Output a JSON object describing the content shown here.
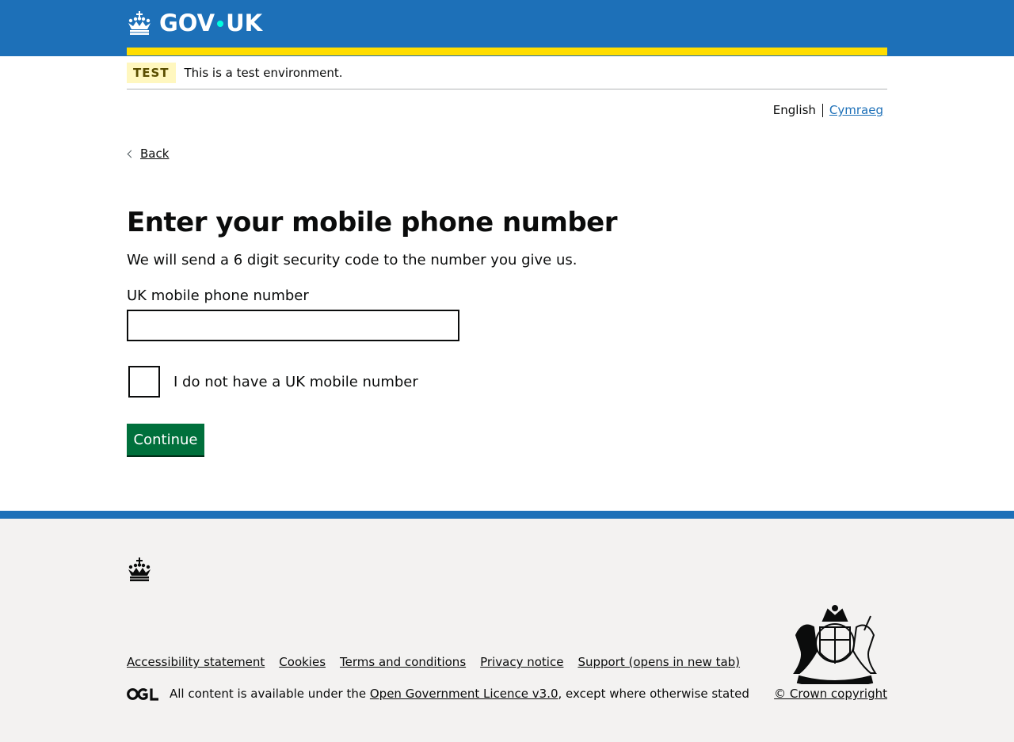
{
  "header": {
    "logo_left": "GOV",
    "logo_right": "UK",
    "brand_color": "#1d70b8",
    "stripe_color": "#ffdd00"
  },
  "phase_banner": {
    "tag": "TEST",
    "text": "This is a test environment."
  },
  "language": {
    "current": "English",
    "other": "Cymraeg"
  },
  "back_link": "Back",
  "main": {
    "title": "Enter your mobile phone number",
    "lede": "We will send a 6 digit security code to the number you give us.",
    "phone_label": "UK mobile phone number",
    "phone_value": "",
    "checkbox_label": "I do not have a UK mobile number",
    "checkbox_checked": false,
    "continue_label": "Continue",
    "button_color": "#00703c"
  },
  "footer": {
    "links": [
      "Accessibility statement",
      "Cookies",
      "Terms and conditions",
      "Privacy notice",
      "Support (opens in new tab)"
    ],
    "licence_prefix": "All content is available under the ",
    "licence_link": "Open Government Licence v3.0",
    "licence_suffix": ", except where otherwise stated",
    "copyright": "© Crown copyright",
    "icons": [
      "crown-icon",
      "ogl-logo-icon",
      "royal-coat-of-arms-icon"
    ]
  }
}
